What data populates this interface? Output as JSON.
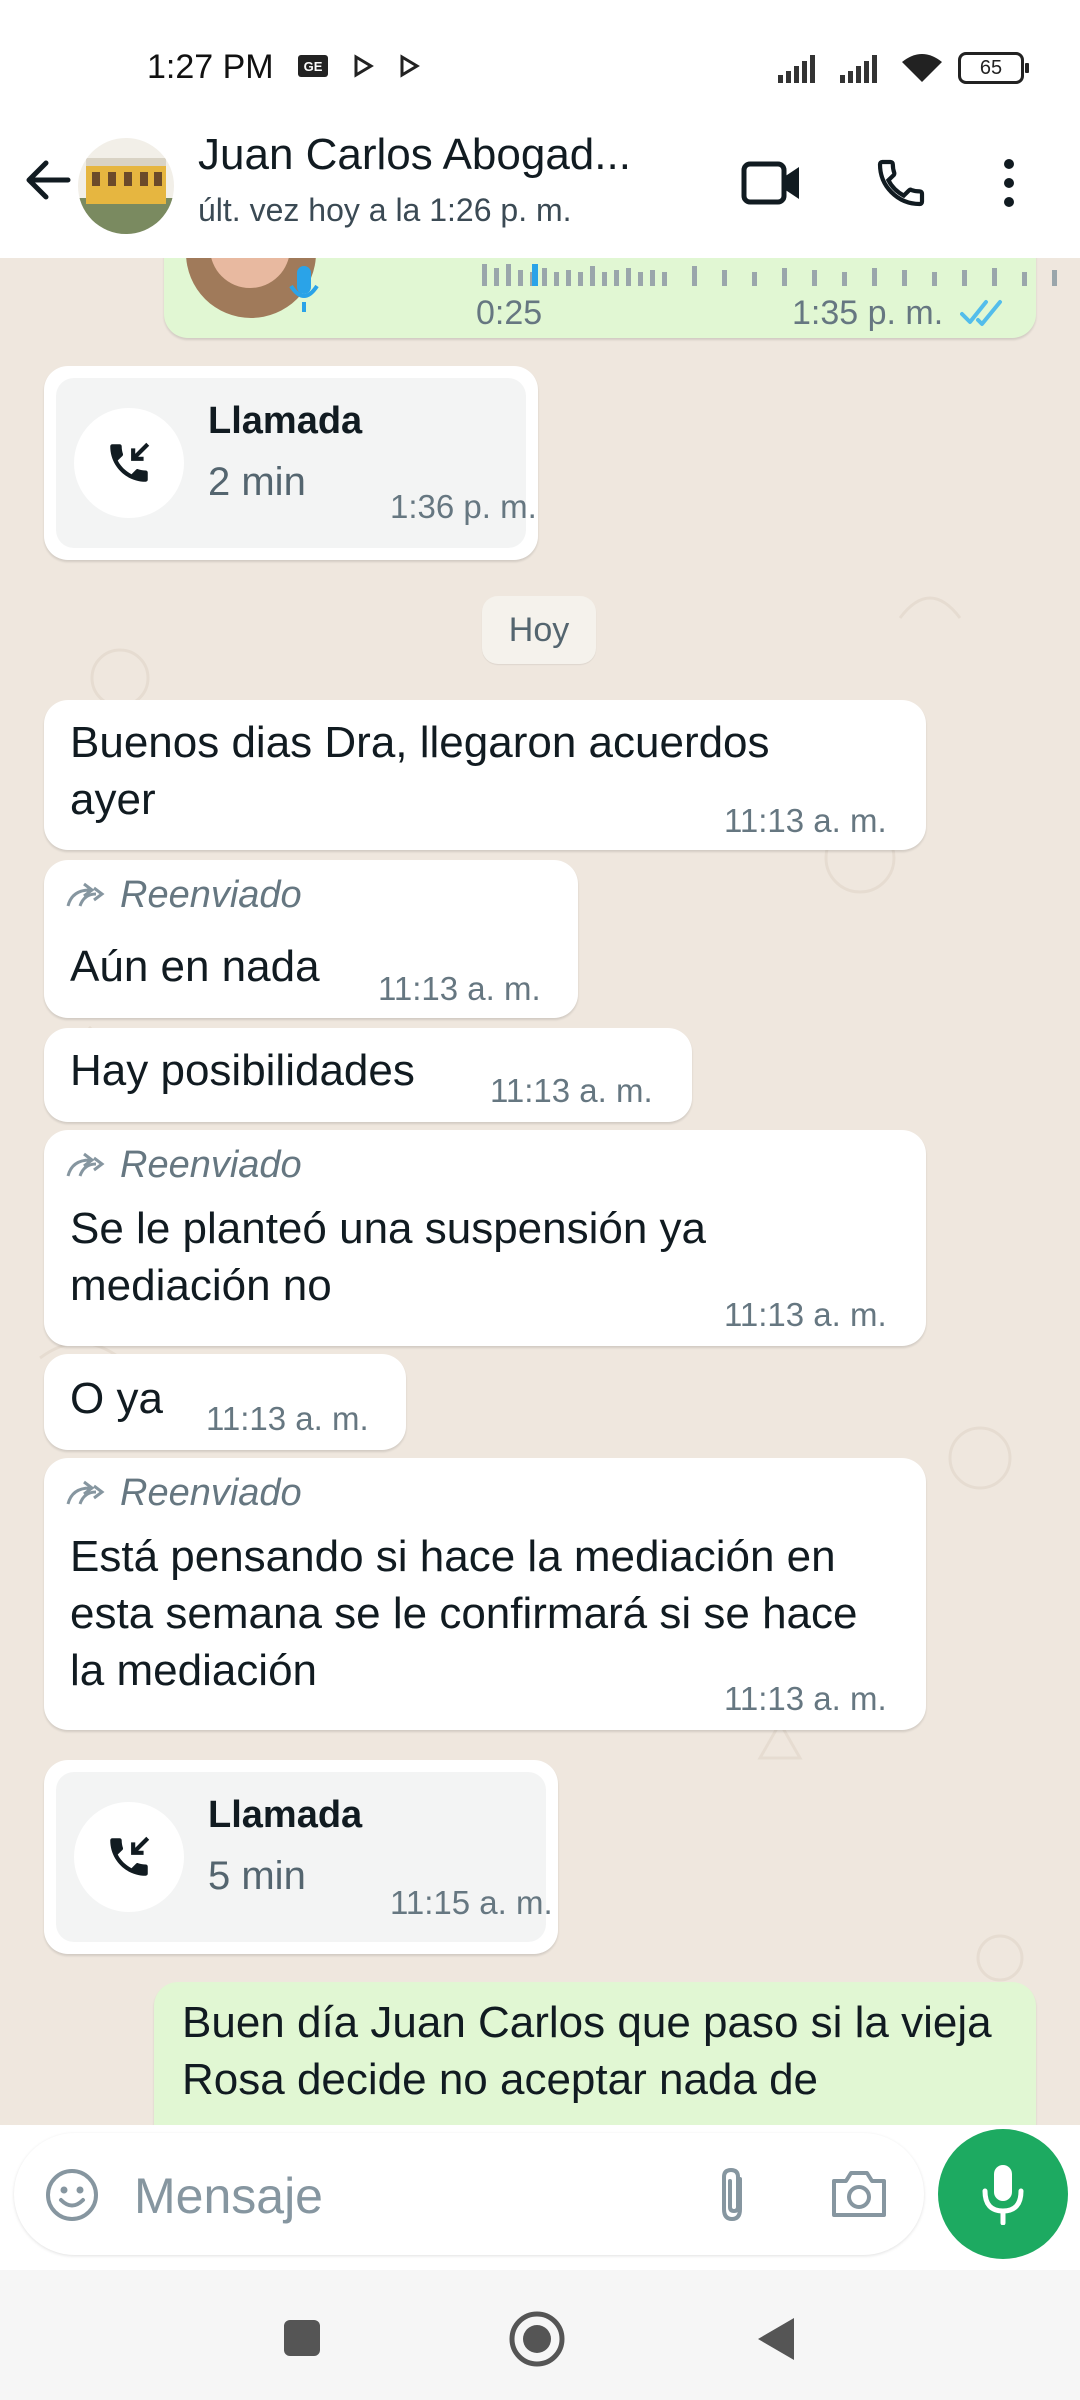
{
  "status_bar": {
    "time": "1:27 PM",
    "battery": "65",
    "icons": [
      "gmail-icon",
      "play-icon",
      "play-icon",
      "signal-icon",
      "signal-icon",
      "wifi-icon"
    ]
  },
  "header": {
    "title": "Juan Carlos Abogad...",
    "subtitle": "últ. vez hoy a la 1:26 p. m.",
    "icons": [
      "back-arrow-icon",
      "video-call-icon",
      "phone-icon",
      "more-vert-icon"
    ]
  },
  "chat": {
    "top_audio": {
      "duration": "0:25",
      "time": "1:35 p. m.",
      "status": "read"
    },
    "call_1": {
      "title": "Llamada",
      "duration": "2 min",
      "time": "1:36 p. m."
    },
    "date_chip": "Hoy",
    "messages": [
      {
        "text": "Buenos dias Dra, llegaron acuerdos ayer",
        "time": "11:13 a. m.",
        "forwarded": false
      },
      {
        "text": "Aún en nada",
        "time": "11:13 a. m.",
        "forwarded": true,
        "forwarded_label": "Reenviado"
      },
      {
        "text": "Hay posibilidades",
        "time": "11:13 a. m.",
        "forwarded": false
      },
      {
        "text": "Se le planteó una suspensión ya mediación no",
        "time": "11:13 a. m.",
        "forwarded": true,
        "forwarded_label": "Reenviado"
      },
      {
        "text": "O ya",
        "time": "11:13 a. m.",
        "forwarded": false
      },
      {
        "text": "Está pensando si hace la mediación en esta semana se le confirmará si se hace la mediación",
        "time": "11:13 a. m.",
        "forwarded": true,
        "forwarded_label": "Reenviado"
      }
    ],
    "call_2": {
      "title": "Llamada",
      "duration": "5 min",
      "time": "11:15 a. m."
    },
    "outgoing_partial": "Buen día Juan Carlos que paso si la vieja Rosa decide no aceptar nada de"
  },
  "composer": {
    "placeholder": "Mensaje",
    "icons": [
      "emoji-icon",
      "attach-icon",
      "camera-icon",
      "mic-icon"
    ]
  },
  "nav_bar": {
    "icons": [
      "recents-icon",
      "home-icon",
      "back-icon"
    ]
  },
  "colors": {
    "chat_bg": "#efe7de",
    "outgoing_bubble": "#e1f7d3",
    "incoming_bubble": "#ffffff",
    "accent_green": "#1daa61",
    "read_ticks": "#53bdeb"
  }
}
